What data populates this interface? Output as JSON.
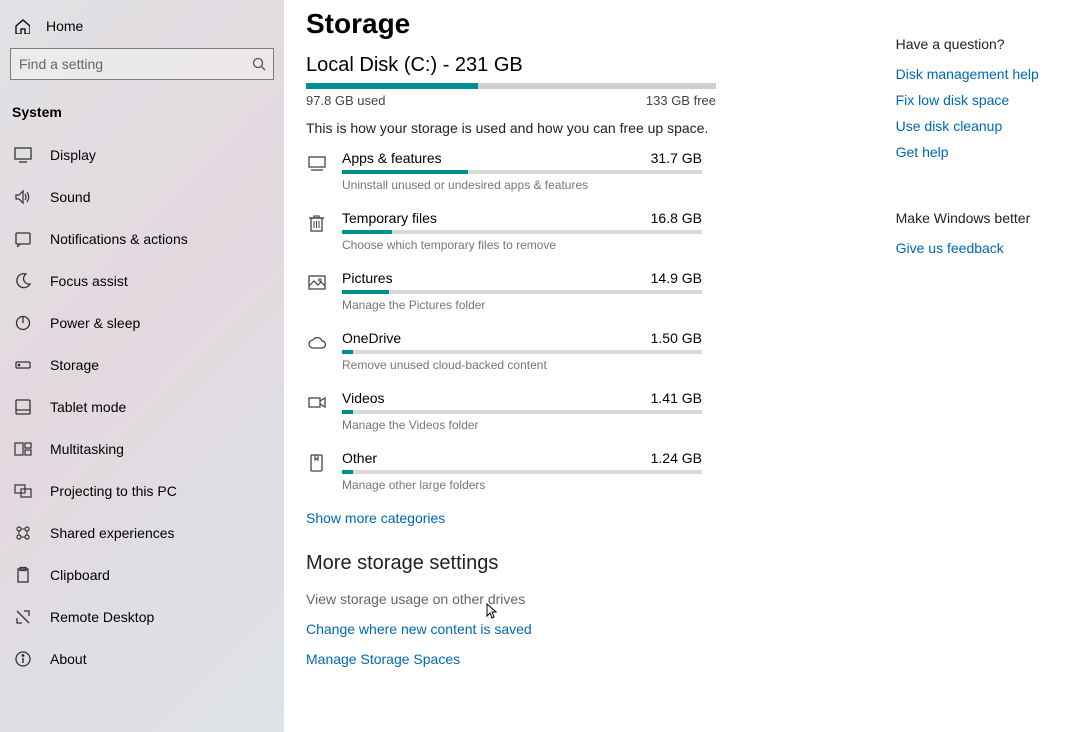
{
  "sidebar": {
    "home": "Home",
    "search_placeholder": "Find a setting",
    "group": "System",
    "items": [
      {
        "label": "Display",
        "icon": "display"
      },
      {
        "label": "Sound",
        "icon": "sound"
      },
      {
        "label": "Notifications & actions",
        "icon": "notifications"
      },
      {
        "label": "Focus assist",
        "icon": "moon"
      },
      {
        "label": "Power & sleep",
        "icon": "power"
      },
      {
        "label": "Storage",
        "icon": "storage"
      },
      {
        "label": "Tablet mode",
        "icon": "tablet"
      },
      {
        "label": "Multitasking",
        "icon": "multitask"
      },
      {
        "label": "Projecting to this PC",
        "icon": "project"
      },
      {
        "label": "Shared experiences",
        "icon": "share"
      },
      {
        "label": "Clipboard",
        "icon": "clipboard"
      },
      {
        "label": "Remote Desktop",
        "icon": "remote"
      },
      {
        "label": "About",
        "icon": "info"
      }
    ]
  },
  "page": {
    "title": "Storage",
    "disk_line": "Local Disk (C:) - 231 GB",
    "used_label": "97.8 GB used",
    "free_label": "133 GB free",
    "used_pct": 42,
    "desc": "This is how your storage is used and how you can free up space.",
    "cats": [
      {
        "name": "Apps & features",
        "size": "31.7 GB",
        "pct": 35,
        "sub": "Uninstall unused or undesired apps & features",
        "icon": "apps"
      },
      {
        "name": "Temporary files",
        "size": "16.8 GB",
        "pct": 14,
        "sub": "Choose which temporary files to remove",
        "icon": "trash"
      },
      {
        "name": "Pictures",
        "size": "14.9 GB",
        "pct": 13,
        "sub": "Manage the Pictures folder",
        "icon": "picture"
      },
      {
        "name": "OneDrive",
        "size": "1.50 GB",
        "pct": 3,
        "sub": "Remove unused cloud-backed content",
        "icon": "cloud"
      },
      {
        "name": "Videos",
        "size": "1.41 GB",
        "pct": 3,
        "sub": "Manage the Videos folder",
        "icon": "video"
      },
      {
        "name": "Other",
        "size": "1.24 GB",
        "pct": 3,
        "sub": "Manage other large folders",
        "icon": "other"
      }
    ],
    "show_more": "Show more categories",
    "more_heading": "More storage settings",
    "view_other": "View storage usage on other drives",
    "change_where": "Change where new content is saved",
    "manage_spaces": "Manage Storage Spaces"
  },
  "aside": {
    "question_h": "Have a question?",
    "links1": [
      "Disk management help",
      "Fix low disk space",
      "Use disk cleanup",
      "Get help"
    ],
    "better_h": "Make Windows better",
    "feedback": "Give us feedback"
  }
}
